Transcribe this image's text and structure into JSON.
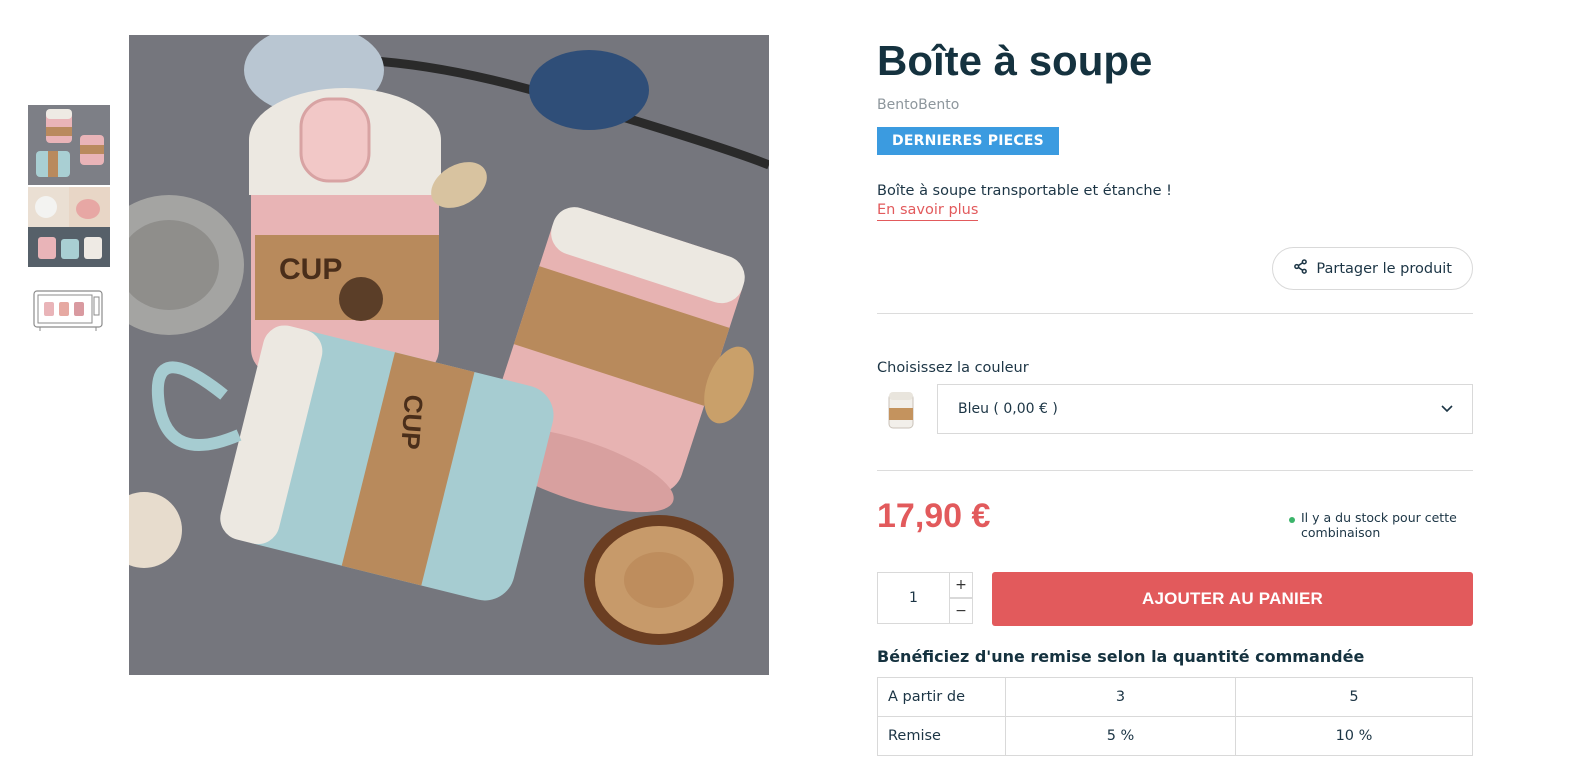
{
  "product": {
    "title": "Boîte à soupe",
    "brand": "BentoBento",
    "badge": "DERNIERES PIECES",
    "short_description": "Boîte à soupe transportable et étanche !",
    "learn_more": "En savoir plus",
    "share_label": "Partager le produit",
    "variant_label": "Choisissez la couleur",
    "variant_selected": "Bleu ( 0,00 € )",
    "price": "17,90 €",
    "stock_text": "Il y a du stock pour cette combinaison",
    "quantity": "1",
    "qty_plus": "+",
    "qty_minus": "−",
    "add_to_cart": "AJOUTER AU PANIER"
  },
  "discount": {
    "title": "Bénéficiez d'une remise selon la quantité commandée",
    "rows": [
      [
        "A partir de",
        "3",
        "5"
      ],
      [
        "Remise",
        "5 %",
        "10 %"
      ]
    ]
  },
  "icons": {
    "share": "share-icon",
    "chevron": "chevron-down-icon",
    "stock": "in-stock-dot-icon"
  },
  "colors": {
    "accent_red": "#e25a5c",
    "badge_blue": "#3b9be0",
    "title_dark": "#15323f",
    "in_stock_green": "#3bb46a"
  }
}
